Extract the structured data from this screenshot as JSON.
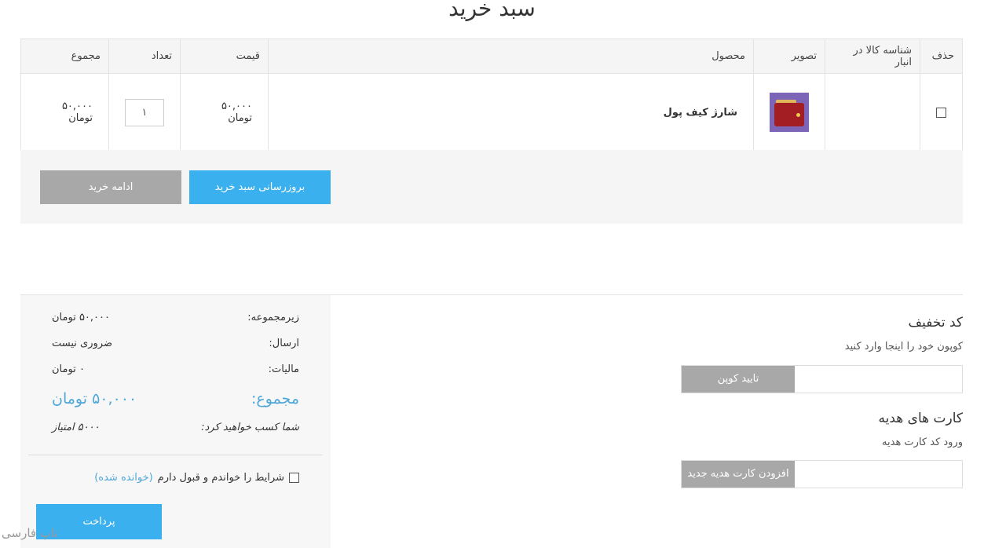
{
  "page": {
    "title": "سبد خرید"
  },
  "table": {
    "headers": {
      "remove": "حذف",
      "sku": "شناسه کالا در انبار",
      "image": "تصویر",
      "product": "محصول",
      "price": "قیمت",
      "quantity": "تعداد",
      "total": "مجموع"
    },
    "rows": [
      {
        "product": "شارژ کیف پول",
        "price": "۵۰,۰۰۰ تومان",
        "quantity": "۱",
        "total": "۵۰,۰۰۰ تومان"
      }
    ]
  },
  "actions": {
    "update_label": "بروزرسانی سبد خرید",
    "continue_label": "ادامه خرید"
  },
  "totals": {
    "subtotal_label": "زیرمجموعه:",
    "subtotal_value": "۵۰,۰۰۰ تومان",
    "shipping_label": "ارسال:",
    "shipping_value": "ضروری نیست",
    "tax_label": "مالیات:",
    "tax_value": "۰ تومان",
    "grand_label": "مجموع:",
    "grand_value": "۵۰,۰۰۰ تومان",
    "points_label": "شما کسب خواهید کرد:",
    "points_value": "۵۰۰۰ امتیاز",
    "terms_label": "شرایط را خواندم و قبول دارم",
    "terms_read": "(خوانده شده)",
    "pay_label": "پرداخت"
  },
  "coupon": {
    "title": "کد تخفیف",
    "desc": "کوپون خود را اینجا وارد کنید",
    "button": "تایید کوپن"
  },
  "gift": {
    "title": "کارت های هدیه",
    "desc": "ورود کد کارت هدیه",
    "button": "افزودن کارت هدیه جدید"
  },
  "watermark": "تاپ فارسی",
  "colors": {
    "accent": "#3bb0ee",
    "secondary_button": "#a8a8a8",
    "total_text": "#4ea7d8"
  }
}
